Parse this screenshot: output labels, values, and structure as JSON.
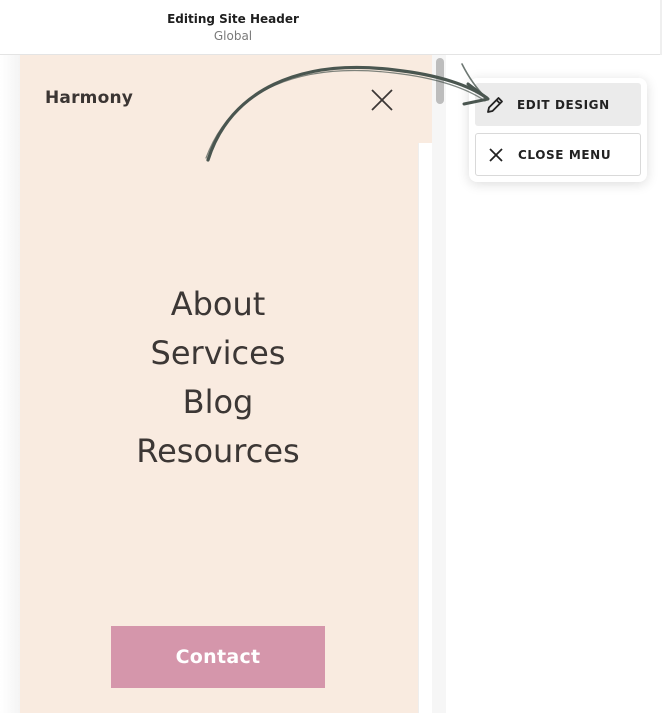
{
  "topbar": {
    "title": "Editing Site Header",
    "subtitle": "Global"
  },
  "preview": {
    "logo": "Harmony",
    "nav": [
      "About",
      "Services",
      "Blog",
      "Resources"
    ],
    "contact_label": "Contact",
    "background_color": "#f9ebe0",
    "contact_color": "#d596ab"
  },
  "menu": {
    "edit_label": "EDIT DESIGN",
    "close_label": "CLOSE MENU"
  },
  "icons": {
    "menu_close": "close-icon",
    "edit": "pencil-icon",
    "close_menu": "close-icon"
  }
}
